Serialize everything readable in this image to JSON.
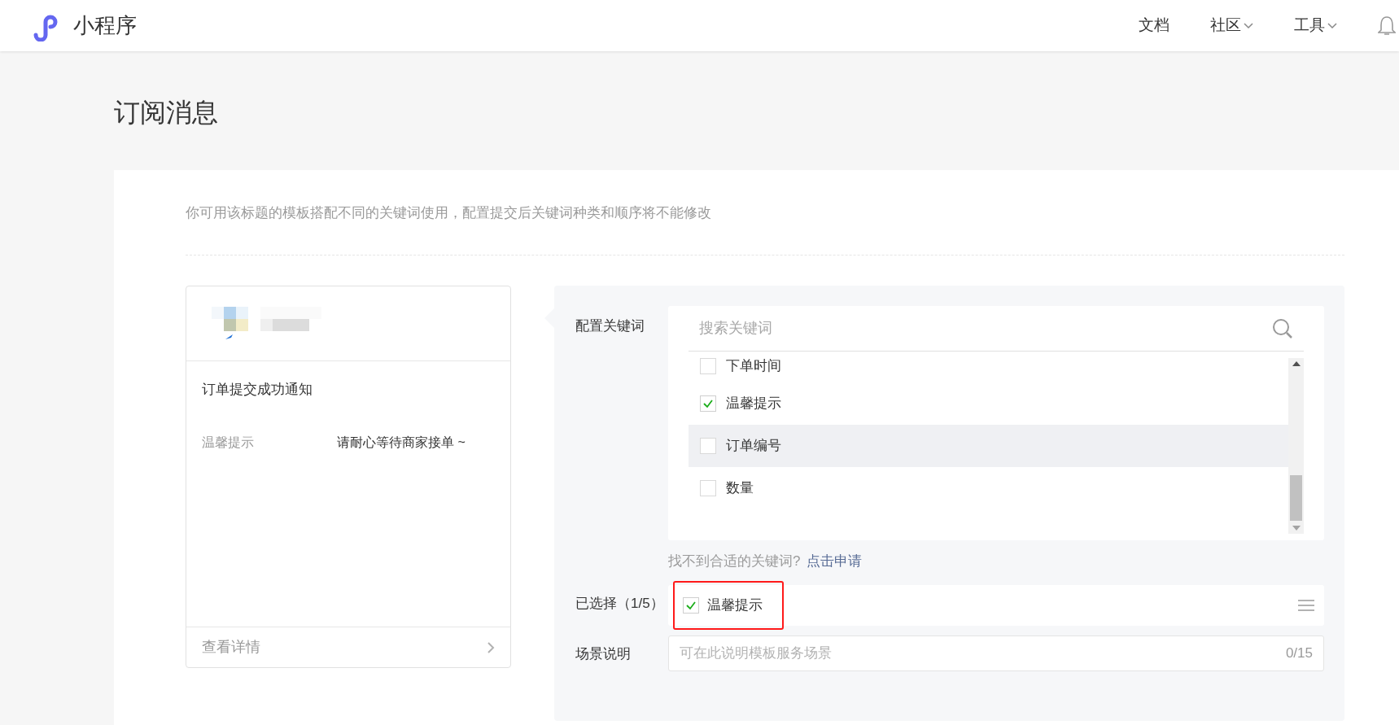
{
  "header": {
    "logo_text": "小程序",
    "nav": [
      {
        "label": "文档",
        "dropdown": false
      },
      {
        "label": "社区",
        "dropdown": true
      },
      {
        "label": "工具",
        "dropdown": true
      }
    ]
  },
  "page_title": "订阅消息",
  "description": "你可用该标题的模板搭配不同的关键词使用，配置提交后关键词种类和顺序将不能修改",
  "preview": {
    "title": "订单提交成功通知",
    "fields": [
      {
        "label": "温馨提示",
        "value": "请耐心等待商家接单 ~"
      }
    ],
    "details_link": "查看详情"
  },
  "config": {
    "keywords_label": "配置关键词",
    "search": {
      "placeholder": "搜索关键词"
    },
    "keywords": [
      {
        "label": "下单时间",
        "checked": false,
        "highlighted": false
      },
      {
        "label": "温馨提示",
        "checked": true,
        "highlighted": false
      },
      {
        "label": "订单编号",
        "checked": false,
        "highlighted": true
      },
      {
        "label": "数量",
        "checked": false,
        "highlighted": false
      }
    ],
    "hint": "找不到合适的关键词?",
    "apply_link": "点击申请",
    "selected_label": "已选择（1/5）",
    "selected": [
      {
        "label": "温馨提示",
        "checked": true
      }
    ],
    "scene_label": "场景说明",
    "scene": {
      "placeholder": "可在此说明模板服务场景",
      "counter": "0/15"
    }
  }
}
